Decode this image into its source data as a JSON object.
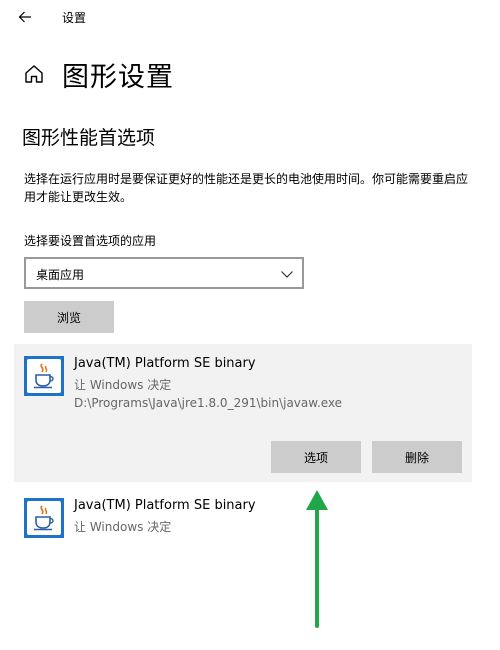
{
  "window": {
    "title": "设置"
  },
  "header": {
    "title": "图形设置"
  },
  "section": {
    "title": "图形性能首选项",
    "description": "选择在运行应用时是要保证更好的性能还是更长的电池使用时间。你可能需要重启应用才能让更改生效。"
  },
  "app_picker": {
    "label": "选择要设置首选项的应用",
    "selected": "桌面应用",
    "browse_label": "浏览"
  },
  "apps": [
    {
      "name": "Java(TM) Platform SE binary",
      "preference": "让 Windows 决定",
      "path": "D:\\Programs\\Java\\jre1.8.0_291\\bin\\javaw.exe",
      "options_label": "选项",
      "delete_label": "删除"
    },
    {
      "name": "Java(TM) Platform SE binary",
      "preference": "让 Windows 决定"
    }
  ],
  "colors": {
    "accent_arrow": "#22a64a",
    "java_icon_bg": "#1e73c9"
  }
}
